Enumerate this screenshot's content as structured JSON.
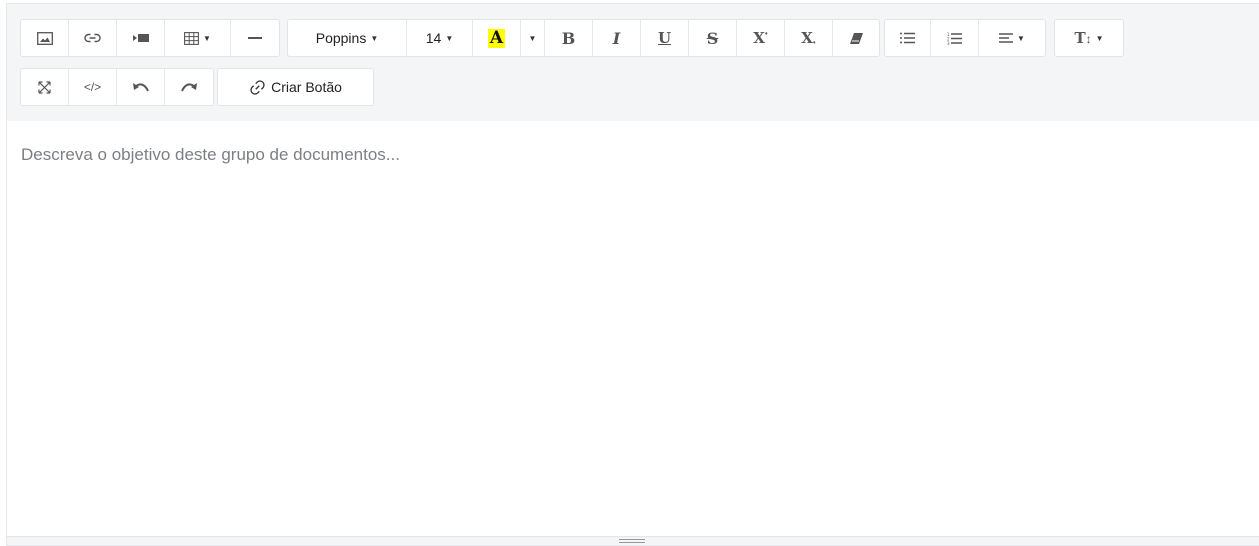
{
  "toolbar": {
    "row1": {
      "insert": [
        {
          "icon": "image-icon"
        },
        {
          "icon": "link-icon"
        },
        {
          "icon": "video-icon"
        },
        {
          "icon": "table-icon"
        },
        {
          "icon": "horizontal-rule-icon"
        }
      ],
      "font_family": "Poppins",
      "font_size": "14",
      "color": {
        "label": "A",
        "highlight": "#ffff00"
      },
      "bold": "B",
      "italic": "I",
      "underline": "U",
      "strikethrough": "S",
      "superscript": "X",
      "subscript": "X",
      "lists": [
        {
          "icon": "unordered-list-icon"
        },
        {
          "icon": "ordered-list-icon"
        }
      ],
      "align": {
        "icon": "align-left-icon"
      },
      "line_height": "T"
    },
    "row2": {
      "view": [
        {
          "icon": "fullscreen-icon"
        },
        {
          "icon": "code-view-icon",
          "label": "</>"
        },
        {
          "icon": "undo-icon"
        },
        {
          "icon": "redo-icon"
        }
      ],
      "create_button": {
        "label": "Criar Botão",
        "icon": "link-icon"
      }
    }
  },
  "editor": {
    "placeholder": "Descreva o objetivo deste grupo de documentos..."
  }
}
